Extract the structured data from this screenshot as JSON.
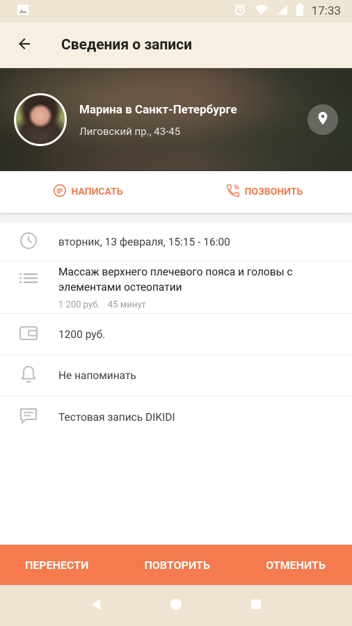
{
  "status_bar": {
    "time": "17:33"
  },
  "app_bar": {
    "title": "Сведения о записи"
  },
  "profile": {
    "name": "Марина в Санкт-Петербурге",
    "address": "Лиговский пр., 43-45"
  },
  "actions": {
    "message_label": "НАПИСАТЬ",
    "call_label": "ПОЗВОНИТЬ"
  },
  "details": {
    "datetime": "вторник, 13 февраля, 15:15 - 16:00",
    "service_title": "Массаж верхнего плечевого пояса и головы с элементами остеопатии",
    "service_price": "1 200 руб.",
    "service_duration": "45 минут",
    "total_price": "1200 руб.",
    "reminder": "Не напоминать",
    "comment": "Тестовая запись DIKIDI"
  },
  "bottom_actions": {
    "reschedule": "ПЕРЕНЕСТИ",
    "repeat": "ПОВТОРИТЬ",
    "cancel": "ОТМЕНИТЬ"
  },
  "colors": {
    "accent": "#f57a4e",
    "app_bar_bg": "#f6efe2",
    "status_bar_bg": "#efe5d3"
  }
}
